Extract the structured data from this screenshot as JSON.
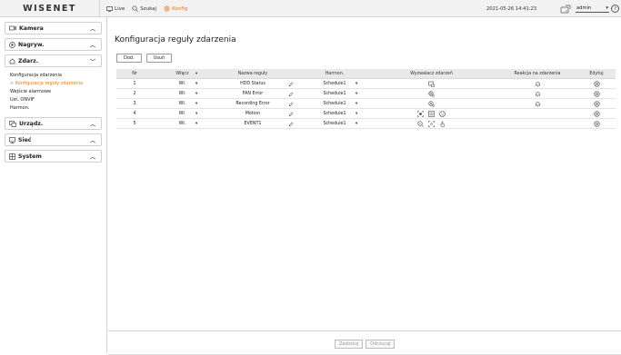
{
  "app": {
    "logo": "WISENET"
  },
  "topnav": [
    {
      "label": "Live",
      "icon": "monitor-icon"
    },
    {
      "label": "Szukaj",
      "icon": "search-icon"
    },
    {
      "label": "Konfig",
      "icon": "gear-icon"
    }
  ],
  "header": {
    "datetime": "2021-05-26 14:41:23",
    "user": "admin",
    "help": "?"
  },
  "sidebar": {
    "sections": [
      {
        "label": "Kamera",
        "icon": "camera-icon",
        "expanded": false
      },
      {
        "label": "Nagryw.",
        "icon": "record-icon",
        "expanded": false
      },
      {
        "label": "Zdarz.",
        "icon": "event-icon",
        "expanded": true,
        "items": [
          "Konfiguracja zdarzenia",
          "Konfiguracja reguły zdarzenia",
          "Wejście alarmowe",
          "Ust. ONVIF",
          "Harmon."
        ]
      },
      {
        "label": "Urządz.",
        "icon": "device-icon",
        "expanded": false
      },
      {
        "label": "Sieć",
        "icon": "network-icon",
        "expanded": false
      },
      {
        "label": "System",
        "icon": "system-icon",
        "expanded": false
      }
    ],
    "active_item": "Konfiguracja reguły zdarzenia"
  },
  "main": {
    "title": "Konfiguracja reguły zdarzenia",
    "add_label": "Dod.",
    "delete_label": "Usuń",
    "columns": [
      "Nr",
      "Włącz",
      "Nazwa reguły",
      "Harmon.",
      "Wyzwalacz zdarzeń",
      "Reakcja na zdarzenia",
      "Edytuj"
    ],
    "rows": [
      {
        "nr": "1",
        "enable": "Wł.",
        "name": "HDD Status",
        "schedule": "Schedule1",
        "triggers": [
          "hdd-status-icon"
        ],
        "reaction": "bell-icon"
      },
      {
        "nr": "2",
        "enable": "Wł.",
        "name": "FAN Error",
        "schedule": "Schedule1",
        "triggers": [
          "fan-error-icon"
        ],
        "reaction": "bell-icon"
      },
      {
        "nr": "3",
        "enable": "Wł.",
        "name": "Recording Error",
        "schedule": "Schedule1",
        "triggers": [
          "recording-error-icon"
        ],
        "reaction": "bell-icon"
      },
      {
        "nr": "4",
        "enable": "Wł.",
        "name": "Motion",
        "schedule": "Schedule1",
        "triggers": [
          "motion-icon",
          "video-analytics-icon",
          "face-icon"
        ],
        "reaction": ""
      },
      {
        "nr": "5",
        "enable": "Wł.",
        "name": "EVENT1",
        "schedule": "Schedule1",
        "triggers": [
          "video-loss-icon",
          "tampering-icon",
          "touch-icon"
        ],
        "reaction": ""
      }
    ],
    "apply_label": "Zastosuj",
    "cancel_label": "Odrzucaj"
  },
  "colors": {
    "accent": "#e07a1f",
    "header_bg": "#e9e9e9",
    "topbar_bg": "#f2f2f2"
  }
}
